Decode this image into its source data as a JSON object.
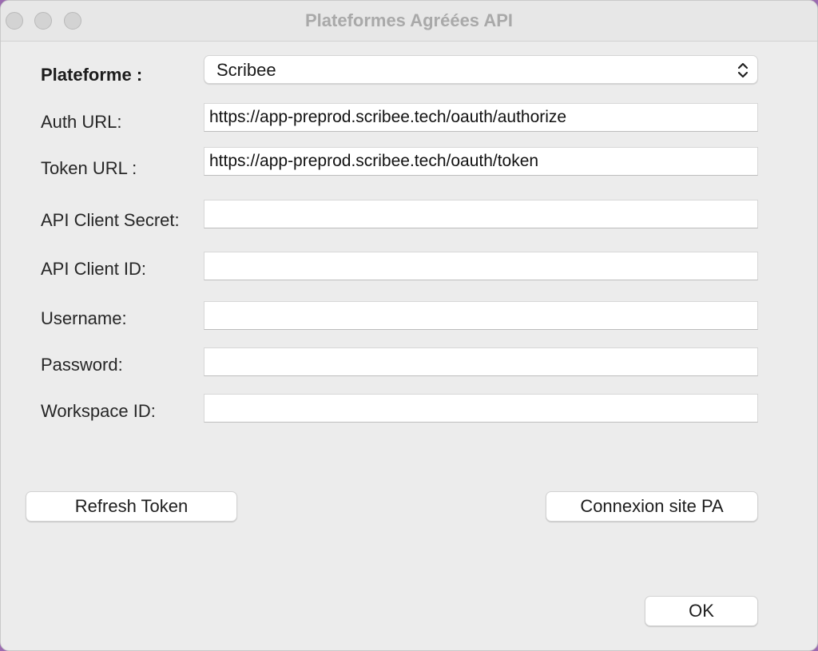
{
  "window": {
    "title": "Plateformes Agréées API"
  },
  "form": {
    "platform": {
      "label": "Plateforme :",
      "selected": "Scribee"
    },
    "auth_url": {
      "label": "Auth URL:",
      "value": "https://app-preprod.scribee.tech/oauth/authorize"
    },
    "token_url": {
      "label": "Token URL :",
      "value": "https://app-preprod.scribee.tech/oauth/token"
    },
    "client_secret": {
      "label": "API Client Secret:",
      "value": ""
    },
    "client_id": {
      "label": "API Client ID:",
      "value": ""
    },
    "username": {
      "label": "Username:",
      "value": ""
    },
    "password": {
      "label": "Password:",
      "value": ""
    },
    "workspace_id": {
      "label": "Workspace ID:",
      "value": ""
    }
  },
  "buttons": {
    "refresh_token": "Refresh Token",
    "connexion_site": "Connexion site PA",
    "ok": "OK"
  },
  "icons": {
    "window_controls": [
      "close-icon",
      "minimize-icon",
      "zoom-icon"
    ],
    "select_arrows": "chevron-up-down-icon"
  }
}
